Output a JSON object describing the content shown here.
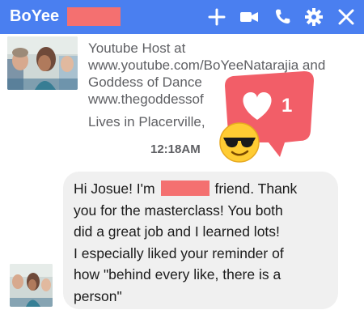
{
  "header": {
    "title": "BoYee",
    "bg_color": "#4a7ff0",
    "icons": [
      "plus-icon",
      "video-camera-icon",
      "phone-icon",
      "gear-icon",
      "close-icon"
    ]
  },
  "profile": {
    "bio_lines": [
      "Youtube Host at",
      "www.youtube.com/BoYeeNatarajia and",
      "Goddess of Dance",
      "www.thegoddessof"
    ],
    "location": "Lives in Placerville,"
  },
  "reaction": {
    "count": "1",
    "icon": "heart-icon",
    "emoji": "sunglasses-emoji",
    "badge_color": "#f25e68"
  },
  "timestamp": "12:18AM",
  "message": {
    "lines": [
      "Hi Josue! I'm",
      "friend. Thank",
      "you for the masterclass! You both",
      "did a great job and I learned lots!",
      "I especially liked your reminder of",
      "how \"behind every like, there is a",
      "person\""
    ],
    "bubble_color": "#f0f0f0"
  },
  "redaction_color": "#f47070"
}
